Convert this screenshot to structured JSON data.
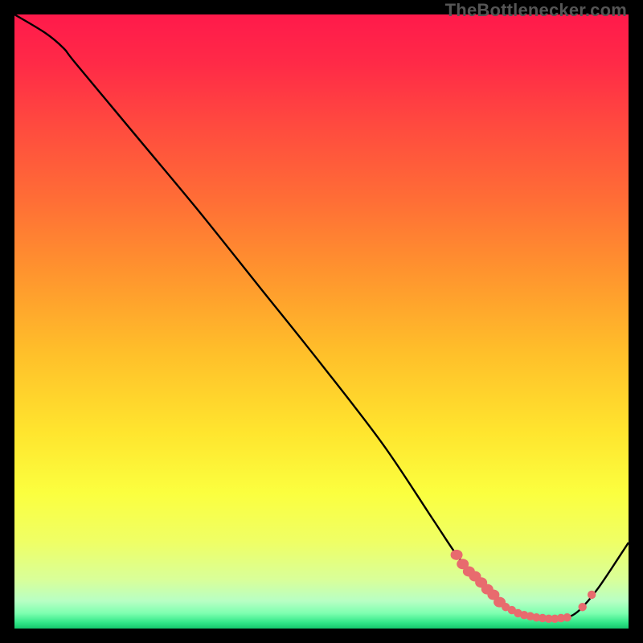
{
  "watermark": "TheBottlenecker.com",
  "colors": {
    "black": "#000000",
    "curve": "#000000",
    "marker": "#e86b6e",
    "watermark": "#555555"
  },
  "chart_data": {
    "type": "line",
    "title": "",
    "xlabel": "",
    "ylabel": "",
    "xlim": [
      0,
      100
    ],
    "ylim": [
      0,
      100
    ],
    "grid": false,
    "gradient_stops": [
      {
        "offset": 0,
        "color": "#ff1a4b"
      },
      {
        "offset": 0.08,
        "color": "#ff2a47"
      },
      {
        "offset": 0.18,
        "color": "#ff4a3f"
      },
      {
        "offset": 0.3,
        "color": "#ff6d36"
      },
      {
        "offset": 0.42,
        "color": "#ff942e"
      },
      {
        "offset": 0.55,
        "color": "#ffbf2a"
      },
      {
        "offset": 0.68,
        "color": "#ffe52e"
      },
      {
        "offset": 0.78,
        "color": "#fbff3f"
      },
      {
        "offset": 0.86,
        "color": "#efff66"
      },
      {
        "offset": 0.92,
        "color": "#d9ff99"
      },
      {
        "offset": 0.955,
        "color": "#b8ffc4"
      },
      {
        "offset": 0.975,
        "color": "#7effb0"
      },
      {
        "offset": 0.99,
        "color": "#33e889"
      },
      {
        "offset": 1.0,
        "color": "#15c86d"
      }
    ],
    "series": [
      {
        "name": "bottleneck-curve",
        "x": [
          0,
          5,
          8,
          10,
          20,
          30,
          40,
          50,
          60,
          68,
          72,
          75,
          78,
          80,
          82,
          85,
          88,
          90,
          92,
          95,
          100
        ],
        "y": [
          100,
          97,
          94.5,
          92,
          80,
          68,
          55.5,
          43,
          30,
          18,
          12,
          8.5,
          5.5,
          3.5,
          2.5,
          1.8,
          1.6,
          1.8,
          3,
          6.5,
          14
        ]
      }
    ],
    "markers": {
      "name": "optimal-zone-dots",
      "x": [
        72,
        73,
        74,
        75,
        76,
        77,
        78,
        79,
        80,
        81,
        82,
        83,
        84,
        85,
        86,
        87,
        88,
        89,
        90,
        92.5,
        94
      ],
      "y": [
        12,
        10.5,
        9.3,
        8.5,
        7.5,
        6.4,
        5.5,
        4.3,
        3.5,
        3.0,
        2.5,
        2.2,
        2.0,
        1.8,
        1.7,
        1.6,
        1.6,
        1.7,
        1.8,
        3.5,
        5.5
      ]
    },
    "dense_marker_range": {
      "x_start": 72,
      "x_end": 79
    }
  }
}
